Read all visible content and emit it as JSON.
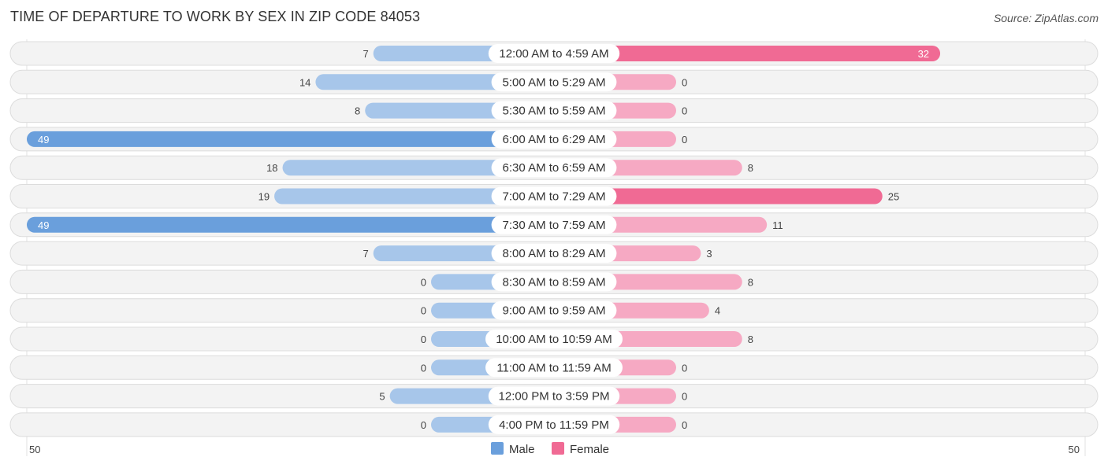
{
  "header": {
    "title": "TIME OF DEPARTURE TO WORK BY SEX IN ZIP CODE 84053",
    "source": "Source: ZipAtlas.com"
  },
  "colors": {
    "male_strong": "#6a9fdc",
    "male_light": "#a7c6ea",
    "female_strong": "#f06a94",
    "female_light": "#f6a9c3"
  },
  "chart_data": {
    "type": "bar",
    "orientation": "horizontal-diverging",
    "title": "TIME OF DEPARTURE TO WORK BY SEX IN ZIP CODE 84053",
    "categories": [
      "12:00 AM to 4:59 AM",
      "5:00 AM to 5:29 AM",
      "5:30 AM to 5:59 AM",
      "6:00 AM to 6:29 AM",
      "6:30 AM to 6:59 AM",
      "7:00 AM to 7:29 AM",
      "7:30 AM to 7:59 AM",
      "8:00 AM to 8:29 AM",
      "8:30 AM to 8:59 AM",
      "9:00 AM to 9:59 AM",
      "10:00 AM to 10:59 AM",
      "11:00 AM to 11:59 AM",
      "12:00 PM to 3:59 PM",
      "4:00 PM to 11:59 PM"
    ],
    "series": [
      {
        "name": "Male",
        "values": [
          7,
          14,
          8,
          49,
          18,
          19,
          49,
          7,
          0,
          0,
          0,
          0,
          5,
          0
        ]
      },
      {
        "name": "Female",
        "values": [
          32,
          0,
          0,
          0,
          8,
          25,
          11,
          3,
          8,
          4,
          8,
          0,
          0,
          0
        ]
      }
    ],
    "axis": {
      "left_label": "50",
      "right_label": "50",
      "range": [
        0,
        50
      ]
    },
    "legend": {
      "position": "bottom-center",
      "entries": [
        "Male",
        "Female"
      ]
    },
    "grid": false
  }
}
